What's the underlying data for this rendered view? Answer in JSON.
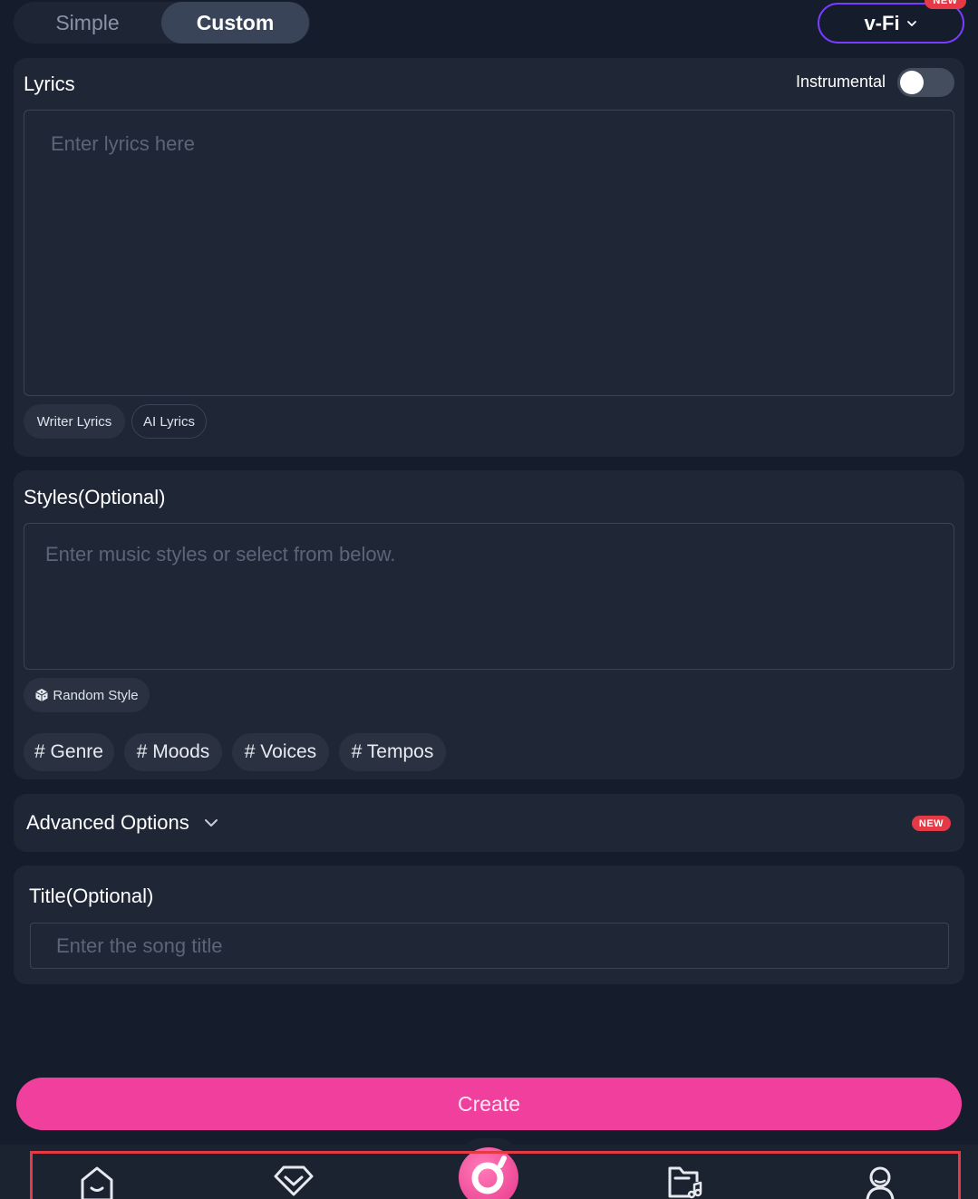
{
  "mode_tabs": {
    "simple": "Simple",
    "custom": "Custom",
    "active": "custom"
  },
  "model_selector": {
    "label": "v-Fi",
    "badge": "NEW",
    "icon": "chevron-down-icon",
    "border_color": "#7a3cff"
  },
  "lyrics": {
    "heading": "Lyrics",
    "instrumental_label": "Instrumental",
    "instrumental_on": false,
    "placeholder": "Enter lyrics here",
    "buttons": [
      "Writer Lyrics",
      "AI Lyrics"
    ]
  },
  "styles": {
    "heading": "Styles(Optional)",
    "placeholder": "Enter music styles or select from below.",
    "random_label": "Random Style",
    "random_icon": "dice-icon",
    "tags": [
      "# Genre",
      "# Moods",
      "# Voices",
      "# Tempos"
    ]
  },
  "advanced": {
    "label": "Advanced Options",
    "badge": "NEW",
    "icon": "chevron-down-icon"
  },
  "title_section": {
    "heading": "Title(Optional)",
    "placeholder": "Enter the song title"
  },
  "create_button": {
    "label": "Create",
    "color": "#f03f9c"
  },
  "bottom_nav": {
    "items": [
      "home-icon",
      "diamond-icon",
      "create-logo-icon",
      "music-folder-icon",
      "profile-icon"
    ],
    "highlight_color": "#e53945"
  }
}
